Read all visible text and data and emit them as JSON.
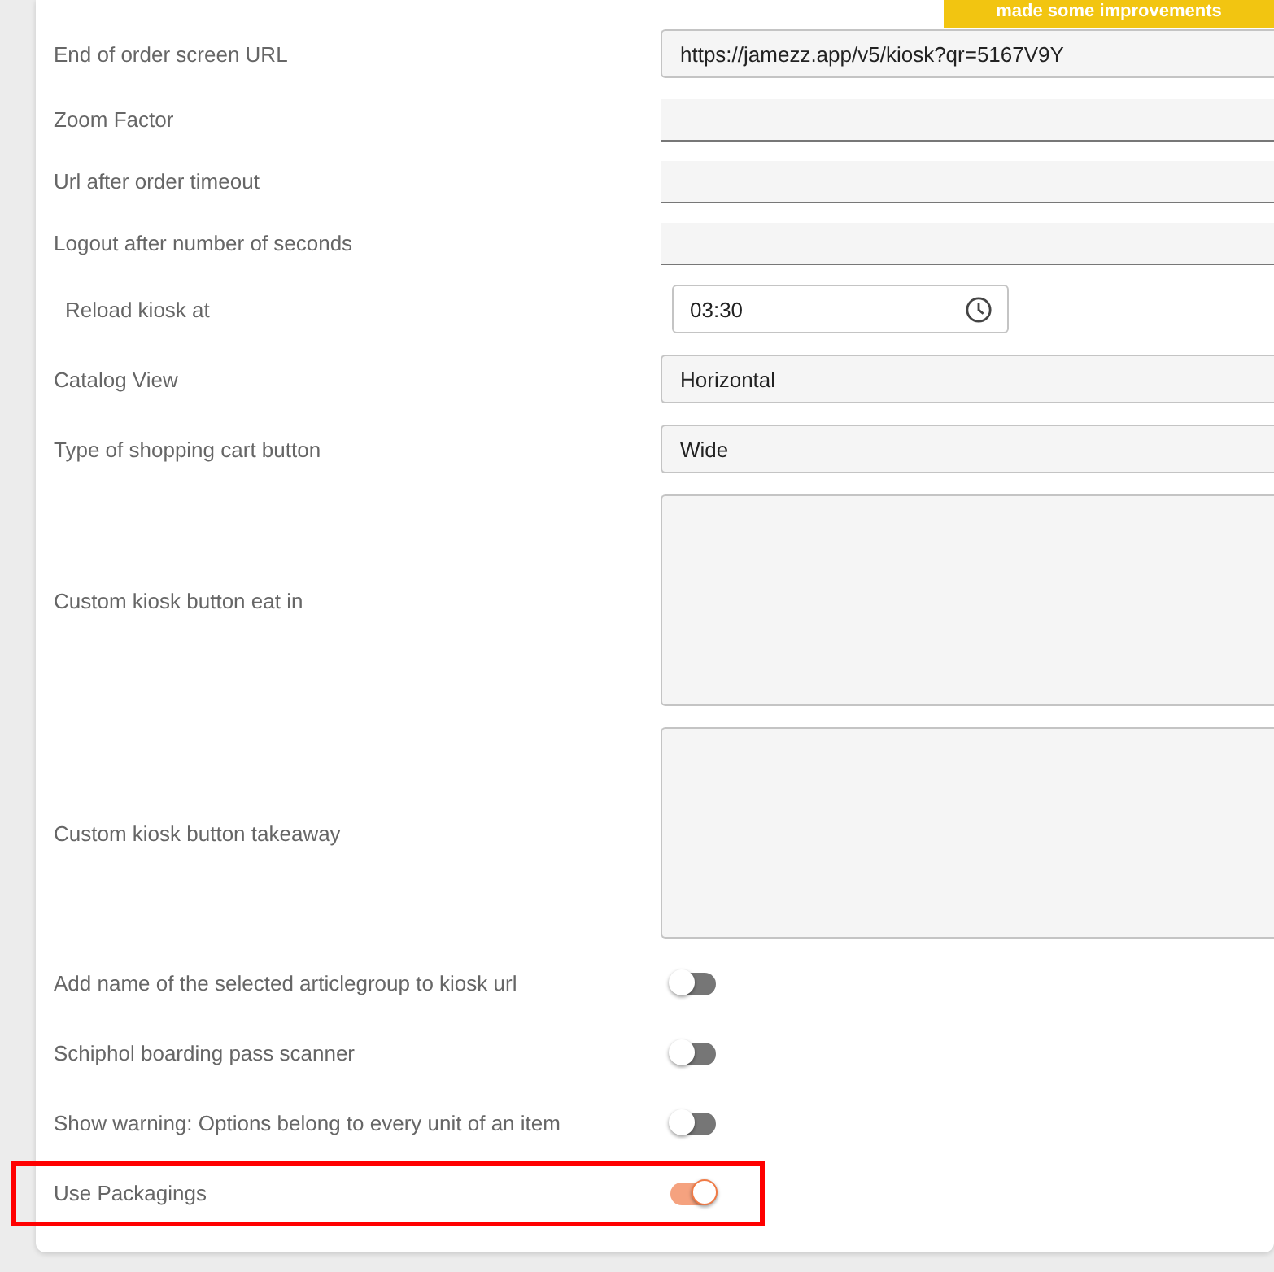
{
  "banner": {
    "text": "made some improvements"
  },
  "settings": [
    {
      "kind": "text",
      "label": "End of order screen URL",
      "value": "https://jamezz.app/v5/kiosk?qr=5167V9Y"
    },
    {
      "kind": "underline",
      "label": "Zoom Factor"
    },
    {
      "kind": "underline",
      "label": "Url after order timeout"
    },
    {
      "kind": "underline",
      "label": "Logout after number of seconds"
    },
    {
      "kind": "time",
      "label": "Reload kiosk at",
      "value": "03:30"
    },
    {
      "kind": "select",
      "label": "Catalog View",
      "value": "Horizontal"
    },
    {
      "kind": "select",
      "label": "Type of shopping cart button",
      "value": "Wide"
    },
    {
      "kind": "textarea",
      "label": "Custom kiosk button eat in"
    },
    {
      "kind": "textarea",
      "label": "Custom kiosk button takeaway"
    },
    {
      "kind": "toggle",
      "label": "Add name of the selected articlegroup to kiosk url",
      "on": false,
      "highlighted": false
    },
    {
      "kind": "toggle",
      "label": "Schiphol boarding pass scanner",
      "on": false,
      "highlighted": false
    },
    {
      "kind": "toggle",
      "label": "Show warning: Options belong to every unit of an item",
      "on": false,
      "highlighted": false
    },
    {
      "kind": "toggle",
      "label": "Use Packagings",
      "on": true,
      "highlighted": true
    }
  ]
}
